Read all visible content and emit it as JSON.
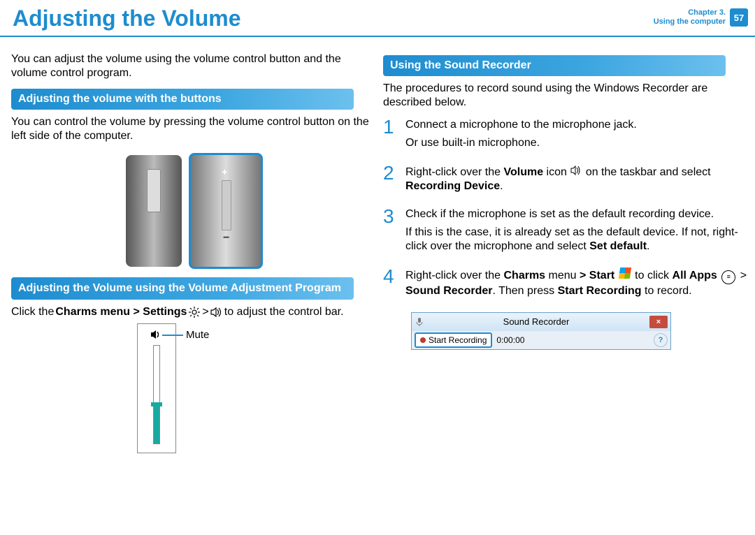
{
  "header": {
    "title": "Adjusting the Volume",
    "chapter_line1": "Chapter 3.",
    "chapter_line2": "Using the computer",
    "page": "57"
  },
  "left": {
    "intro": "You can adjust the volume using the volume control button and the volume control program.",
    "sec1_title": "Adjusting the volume with the buttons",
    "sec1_body": "You can control the volume by pressing the volume control button on the left side of the computer.",
    "sec2_title": "Adjusting the Volume using the Volume Adjustment Program",
    "charms_prefix": "Click the",
    "charms_bold": "Charms menu > Settings",
    "charms_mid": " > ",
    "charms_suffix": " to adjust the control bar.",
    "mute_label": "Mute"
  },
  "right": {
    "sec_title": "Using the Sound Recorder",
    "intro": "The procedures to record sound using the Windows Recorder are described below.",
    "steps": [
      {
        "num": "1",
        "lines": [
          "Connect a microphone to the microphone jack.",
          "Or use built-in microphone."
        ]
      },
      {
        "num": "2",
        "pre": "Right-click over the",
        "bold1": "Volume",
        "mid": " icon",
        "post": " on the taskbar and select ",
        "bold2": "Recording Device",
        "end": "."
      },
      {
        "num": "3",
        "lines": [
          "Check if the microphone is set as the default recording device.",
          "If this is the case, it is already set as the default device. If not, right-click over the microphone and select "
        ],
        "bold_tail": "Set default",
        "end": "."
      },
      {
        "num": "4",
        "pre": "Right-click over the",
        "bold1": "Charms",
        "t1": " menu",
        "bold2": "> Start",
        "t2": " to click",
        "bold3": "All Apps",
        "t3": " > ",
        "bold4": "Sound Recorder",
        "t4": ". Then press",
        "bold5": "Start Recording",
        "t5": " to record."
      }
    ],
    "sr": {
      "title": "Sound Recorder",
      "button": "Start Recording",
      "time": "0:00:00",
      "close": "×",
      "help": "?"
    }
  }
}
